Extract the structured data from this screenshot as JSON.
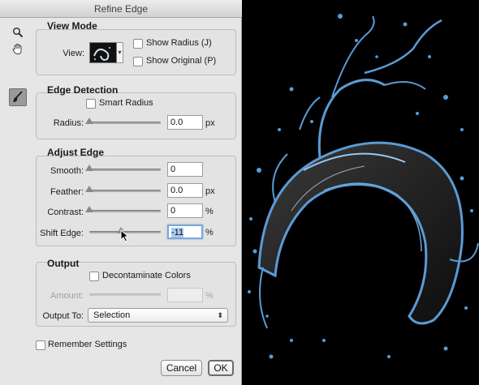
{
  "dialog": {
    "title": "Refine Edge"
  },
  "tools": [
    {
      "name": "zoom-tool",
      "icon": "magnifier-icon"
    },
    {
      "name": "hand-tool",
      "icon": "hand-icon"
    },
    {
      "name": "refine-radius-tool",
      "icon": "brush-icon"
    }
  ],
  "view_mode": {
    "title": "View Mode",
    "view_label": "View:",
    "show_radius_label": "Show Radius (J)",
    "show_original_label": "Show Original (P)"
  },
  "edge_detection": {
    "title": "Edge Detection",
    "smart_radius_label": "Smart Radius",
    "radius_label": "Radius:",
    "radius_value": "0.0",
    "radius_unit": "px"
  },
  "adjust_edge": {
    "title": "Adjust Edge",
    "smooth_label": "Smooth:",
    "smooth_value": "0",
    "feather_label": "Feather:",
    "feather_value": "0.0",
    "feather_unit": "px",
    "contrast_label": "Contrast:",
    "contrast_value": "0",
    "contrast_unit": "%",
    "shift_edge_label": "Shift Edge:",
    "shift_edge_value": "-11",
    "shift_edge_unit": "%"
  },
  "output": {
    "title": "Output",
    "decontaminate_label": "Decontaminate Colors",
    "amount_label": "Amount:",
    "amount_unit": "%",
    "output_to_label": "Output To:",
    "output_to_value": "Selection"
  },
  "footer": {
    "remember_label": "Remember Settings",
    "cancel_label": "Cancel",
    "ok_label": "OK"
  },
  "colors": {
    "dialog_bg": "#e6e6e6",
    "preview_bg": "#000000",
    "splash_edge": "#5b9bd5",
    "focus_ring": "#7da7d9"
  }
}
